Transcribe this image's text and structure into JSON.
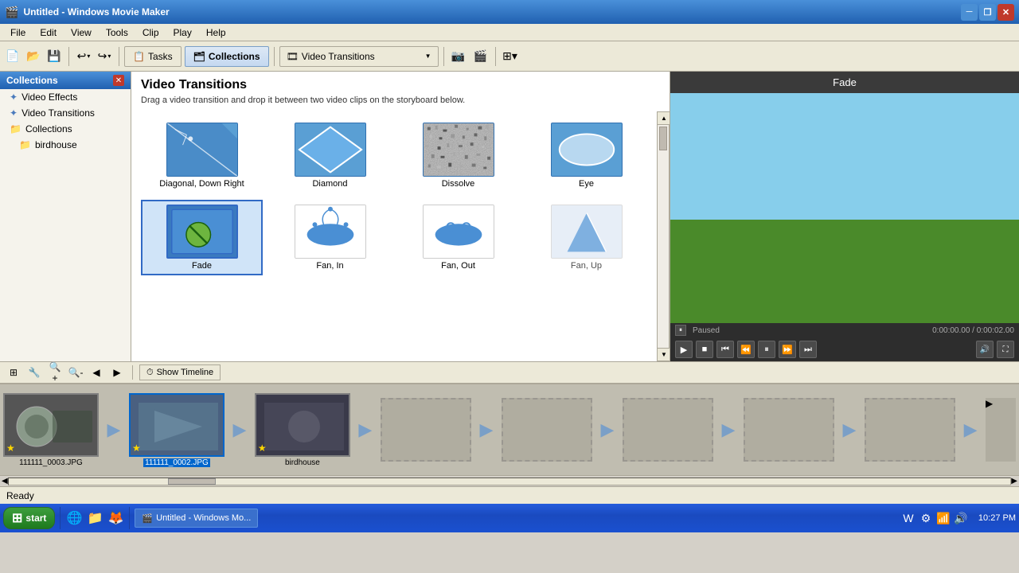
{
  "titlebar": {
    "title": "Untitled - Windows Movie Maker",
    "icon": "🎬",
    "minimize": "🗕",
    "maximize": "🗗",
    "close": "✕"
  },
  "menu": {
    "items": [
      "File",
      "Edit",
      "View",
      "Tools",
      "Clip",
      "Play",
      "Help"
    ]
  },
  "toolbar": {
    "tasks_label": "Tasks",
    "collections_label": "Collections",
    "dropdown_label": "Video Transitions"
  },
  "leftpanel": {
    "header": "Collections",
    "items": [
      {
        "label": "Video Effects",
        "icon": "✦",
        "indent": 0
      },
      {
        "label": "Video Transitions",
        "icon": "✦",
        "indent": 0
      },
      {
        "label": "Collections",
        "icon": "📁",
        "indent": 0
      },
      {
        "label": "birdhouse",
        "icon": "📁",
        "indent": 1
      }
    ]
  },
  "centerpanel": {
    "title": "Video Transitions",
    "description": "Drag a video transition and drop it between two video clips on the storyboard below.",
    "transitions": [
      {
        "label": "Diagonal, Down Right",
        "shape": "diagonal"
      },
      {
        "label": "Diamond",
        "shape": "diamond"
      },
      {
        "label": "Dissolve",
        "shape": "dissolve"
      },
      {
        "label": "Eye",
        "shape": "eye"
      },
      {
        "label": "Fade",
        "shape": "fade",
        "selected": true
      },
      {
        "label": "Fan, In",
        "shape": "fan-in"
      },
      {
        "label": "Fan, Out",
        "shape": "fan-out"
      },
      {
        "label": "Fan, Up",
        "shape": "fan-up"
      }
    ]
  },
  "preview": {
    "title": "Fade",
    "status": "Paused",
    "time": "0:00:00.00 / 0:00:02.00"
  },
  "storyboard": {
    "show_timeline_label": "Show Timeline",
    "clips": [
      {
        "label": "111111_0003.JPG",
        "selected": false,
        "has_star": true
      },
      {
        "label": "111111_0002.JPG",
        "selected": true,
        "has_star": true
      },
      {
        "label": "birdhouse",
        "selected": false,
        "has_star": true
      }
    ]
  },
  "statusbar": {
    "text": "Ready"
  },
  "taskbar": {
    "start_label": "start",
    "app_label": "Untitled - Windows Mo...",
    "time": "10:27 PM"
  }
}
